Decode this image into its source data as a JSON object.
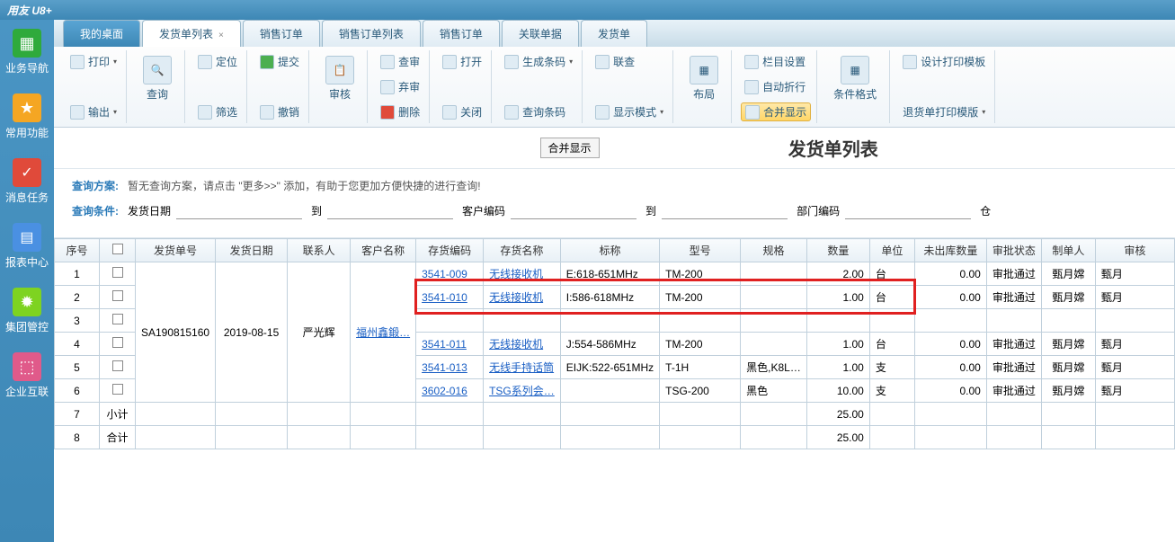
{
  "app_title": "用友 U8+",
  "sidebar": [
    {
      "label": "业务导航",
      "color": "#2faa3c"
    },
    {
      "label": "常用功能",
      "color": "#f5a623"
    },
    {
      "label": "消息任务",
      "color": "#e04a3a"
    },
    {
      "label": "报表中心",
      "color": "#4a90e2"
    },
    {
      "label": "集团管控",
      "color": "#7ed321"
    },
    {
      "label": "企业互联",
      "color": "#e05a8a"
    }
  ],
  "tabs": [
    {
      "label": "我的桌面",
      "active": false,
      "first": true
    },
    {
      "label": "发货单列表",
      "active": true,
      "closable": true
    },
    {
      "label": "销售订单",
      "active": false
    },
    {
      "label": "销售订单列表",
      "active": false
    },
    {
      "label": "销售订单",
      "active": false
    },
    {
      "label": "关联单据",
      "active": false
    },
    {
      "label": "发货单",
      "active": false
    }
  ],
  "ribbon": {
    "print": "打印",
    "output": "输出",
    "query": "查询",
    "locate": "定位",
    "filter": "筛选",
    "submit": "提交",
    "revoke": "撤销",
    "audit": "审核",
    "approve": "查审",
    "abandon": "弃审",
    "delete": "删除",
    "open": "打开",
    "close": "关闭",
    "barcode": "生成条码",
    "qbarcode": "查询条码",
    "link": "联查",
    "display": "显示模式",
    "layout": "布局",
    "col": "栏目设置",
    "wrap": "自动折行",
    "merge": "合并显示",
    "fmt": "条件格式",
    "tpl": "设计打印模板",
    "rtpl": "退货单打印模版"
  },
  "page": {
    "title": "发货单列表",
    "merge_btn": "合并显示"
  },
  "query": {
    "plan_label": "查询方案:",
    "plan_text": "暂无查询方案，请点击 \"更多>>\" 添加，有助于您更加方便快捷的进行查询!",
    "cond_label": "查询条件:",
    "date_label": "发货日期",
    "to": "到",
    "cust": "客户编码",
    "dept": "部门编码",
    "wh": "仓"
  },
  "columns": [
    "序号",
    "",
    "发货单号",
    "发货日期",
    "联系人",
    "客户名称",
    "存货编码",
    "存货名称",
    "标称",
    "型号",
    "规格",
    "数量",
    "单位",
    "未出库数量",
    "审批状态",
    "制单人",
    "审核"
  ],
  "rows": [
    {
      "n": "1",
      "code": "3541-009",
      "name": "无线接收机",
      "spec": "E:618-651MHz",
      "model": "TM-200",
      "std": "",
      "qty": "2.00",
      "unit": "台",
      "pend": "0.00",
      "status": "审批通过",
      "maker": "甄月嫦",
      "aud": "甄月"
    },
    {
      "n": "2",
      "code": "3541-010",
      "name": "无线接收机",
      "spec": "I:586-618MHz",
      "model": "TM-200",
      "std": "",
      "qty": "1.00",
      "unit": "台",
      "pend": "0.00",
      "status": "审批通过",
      "maker": "甄月嫦",
      "aud": "甄月",
      "hl": true
    },
    {
      "n": "3",
      "code": "",
      "name": "",
      "spec": "",
      "model": "",
      "std": "",
      "qty": "",
      "unit": "",
      "pend": "",
      "status": "",
      "maker": "",
      "aud": ""
    },
    {
      "n": "4",
      "code": "3541-011",
      "name": "无线接收机",
      "spec": "J:554-586MHz",
      "model": "TM-200",
      "std": "",
      "qty": "1.00",
      "unit": "台",
      "pend": "0.00",
      "status": "审批通过",
      "maker": "甄月嫦",
      "aud": "甄月"
    },
    {
      "n": "5",
      "code": "3541-013",
      "name": "无线手持话筒",
      "spec": "EIJK:522-651MHz",
      "model": "T-1H",
      "std": "黑色,K8L…",
      "qty": "1.00",
      "unit": "支",
      "pend": "0.00",
      "status": "审批通过",
      "maker": "甄月嫦",
      "aud": "甄月"
    },
    {
      "n": "6",
      "code": "3602-016",
      "name": "TSG系列会…",
      "spec": "",
      "model": "TSG-200",
      "std": "黑色",
      "qty": "10.00",
      "unit": "支",
      "pend": "0.00",
      "status": "审批通过",
      "maker": "甄月嫦",
      "aud": "甄月"
    }
  ],
  "merged": {
    "doc": "SA190815160",
    "date": "2019-08-15",
    "contact": "严光辉",
    "cust": "福州鑫鍛…"
  },
  "subtotal": {
    "n": "7",
    "label": "小计",
    "qty": "25.00"
  },
  "total": {
    "n": "8",
    "label": "合计",
    "qty": "25.00"
  }
}
